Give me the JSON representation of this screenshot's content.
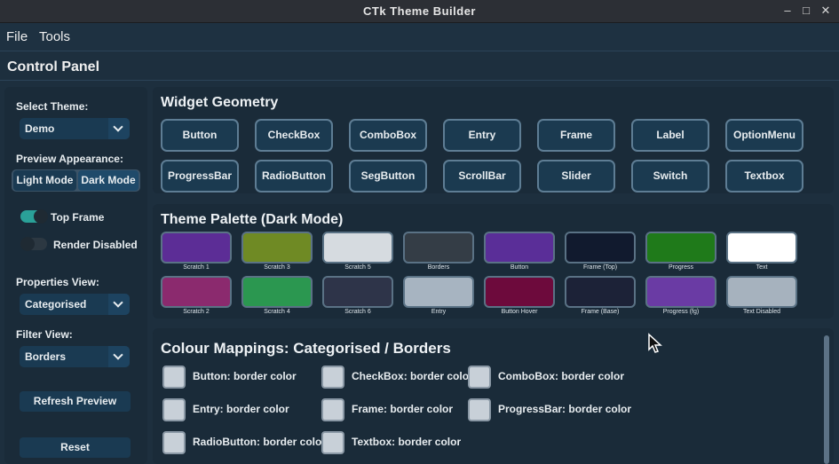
{
  "window": {
    "title": "CTk Theme Builder"
  },
  "menu": {
    "file": "File",
    "tools": "Tools"
  },
  "control_panel": {
    "title": "Control Panel",
    "select_theme_label": "Select Theme:",
    "select_theme_value": "Demo",
    "preview_appearance_label": "Preview Appearance:",
    "light_mode": "Light Mode",
    "dark_mode": "Dark Mode",
    "top_frame": "Top Frame",
    "render_disabled": "Render Disabled",
    "properties_view_label": "Properties View:",
    "properties_view_value": "Categorised",
    "filter_view_label": "Filter View:",
    "filter_view_value": "Borders",
    "refresh_preview": "Refresh Preview",
    "reset": "Reset"
  },
  "geometry": {
    "title": "Widget Geometry",
    "widgets": [
      "Button",
      "CheckBox",
      "ComboBox",
      "Entry",
      "Frame",
      "Label",
      "OptionMenu",
      "ProgressBar",
      "RadioButton",
      "SegButton",
      "ScrollBar",
      "Slider",
      "Switch",
      "Textbox"
    ]
  },
  "palette": {
    "title": "Theme Palette (Dark Mode)",
    "swatches": [
      {
        "label": "Scratch 1",
        "color": "#5c2d96"
      },
      {
        "label": "Scratch 3",
        "color": "#6f8a24"
      },
      {
        "label": "Scratch 5",
        "color": "#d6dbe0"
      },
      {
        "label": "Borders",
        "color": "#343d46"
      },
      {
        "label": "Button",
        "color": "#5a2e98"
      },
      {
        "label": "Frame (Top)",
        "color": "#111a2e"
      },
      {
        "label": "Progress",
        "color": "#1f7a1a"
      },
      {
        "label": "Text",
        "color": "#ffffff"
      },
      {
        "label": "Scratch 2",
        "color": "#8b2a6e"
      },
      {
        "label": "Scratch 4",
        "color": "#2b9750"
      },
      {
        "label": "Scratch 6",
        "color": "#2e3449"
      },
      {
        "label": "Entry",
        "color": "#a7b4c1"
      },
      {
        "label": "Button Hover",
        "color": "#6d0a3c"
      },
      {
        "label": "Frame (Base)",
        "color": "#1c2237"
      },
      {
        "label": "Progress (fg)",
        "color": "#6a3ba4"
      },
      {
        "label": "Text Disabled",
        "color": "#a6b2be"
      }
    ]
  },
  "mappings": {
    "title": "Colour Mappings: Categorised / Borders",
    "items": [
      "Button: border color",
      "CheckBox: border color",
      "ComboBox: border color",
      "Entry: border color",
      "Frame: border color",
      "ProgressBar: border color",
      "RadioButton: border color",
      "Textbox: border color"
    ]
  },
  "colors": {
    "accent": "#1a3a52",
    "switch_on": "#2aa198",
    "background": "#1d2f3e"
  }
}
